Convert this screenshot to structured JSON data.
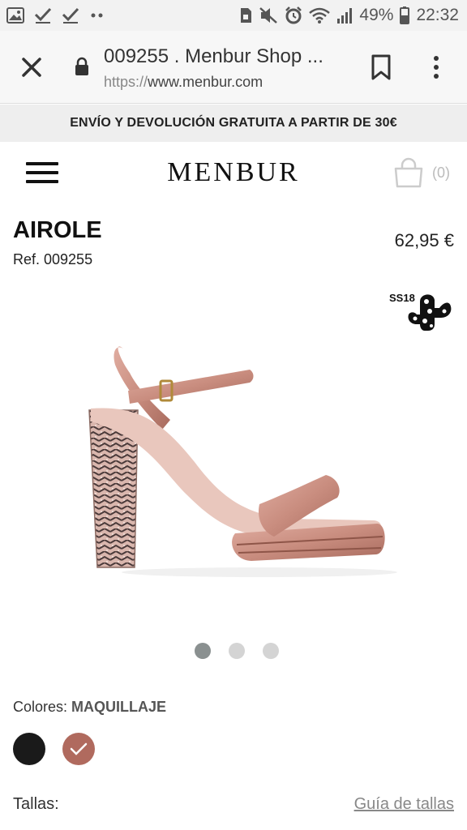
{
  "status_bar": {
    "battery": "49%",
    "time": "22:32",
    "left_icons": [
      "image-icon",
      "check-icon",
      "check-icon",
      "dots-icon"
    ],
    "right_icons": [
      "sim-icon",
      "mute-icon",
      "alarm-icon",
      "wifi-icon",
      "signal-icon",
      "battery-icon"
    ]
  },
  "browser": {
    "page_title": "009255 . Menbur Shop ...",
    "url_scheme": "https://",
    "url_host": "www.menbur.com"
  },
  "promo": {
    "text": "ENVÍO Y DEVOLUCIÓN GRATUITA A PARTIR DE 30€"
  },
  "header": {
    "logo": "MENBUR",
    "cart_count": "(0)"
  },
  "product": {
    "name": "AIROLE",
    "ref": "Ref. 009255",
    "price": "62,95 €",
    "season_badge": "SS18"
  },
  "carousel": {
    "total": 3,
    "active_index": 0
  },
  "colors": {
    "label": "Colores:",
    "selected": "MAQUILLAJE",
    "swatches": [
      {
        "name": "black",
        "hex": "#1a1a1a",
        "selected": false
      },
      {
        "name": "maquillaje",
        "hex": "#b06a5e",
        "selected": true
      }
    ]
  },
  "sizes": {
    "label": "Tallas:",
    "guide_link": "Guía de tallas"
  },
  "colors_theme": {
    "accent_dot_active": "#8a9090",
    "banner_bg": "#eeeeee",
    "shoe_satin": "#c98d7f"
  }
}
